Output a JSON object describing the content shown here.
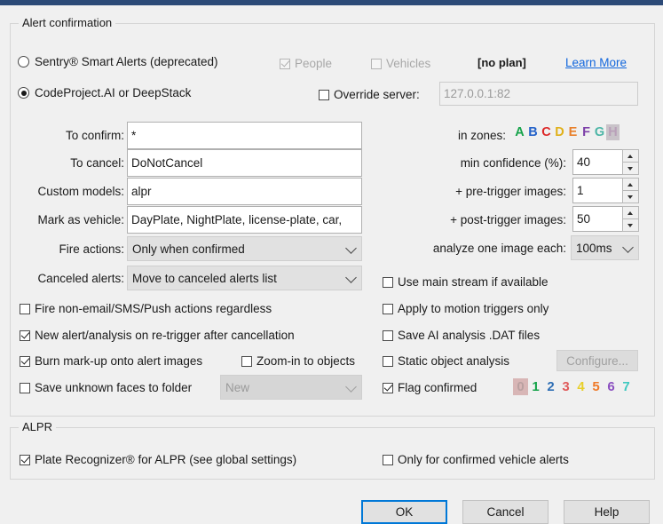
{
  "window": {
    "titlebar_color": "#2c4a77"
  },
  "alert_group": {
    "legend": "Alert confirmation",
    "radios": [
      {
        "label": "Sentry® Smart Alerts (deprecated)",
        "checked": false
      },
      {
        "label": "CodeProject.AI or DeepStack",
        "checked": true
      }
    ],
    "sentry_options": [
      {
        "label": "People",
        "checked": true,
        "disabled": true
      },
      {
        "label": "Vehicles",
        "checked": false,
        "disabled": true
      }
    ],
    "plan_text": "[no plan]",
    "learn_more": "Learn More",
    "override_server": {
      "label": "Override server:",
      "checked": false,
      "value": "127.0.0.1:82",
      "disabled": true
    },
    "fields": [
      {
        "label": "To confirm:",
        "value": "*"
      },
      {
        "label": "To cancel:",
        "value": "DoNotCancel"
      },
      {
        "label": "Custom models:",
        "value": "alpr"
      },
      {
        "label": "Mark as vehicle:",
        "value": "DayPlate, NightPlate, license-plate, car,"
      }
    ],
    "combos": [
      {
        "label": "Fire actions:",
        "value": "Only when confirmed"
      },
      {
        "label": "Canceled alerts:",
        "value": "Move to canceled alerts list"
      }
    ],
    "zones": {
      "label": "in zones:",
      "items": [
        {
          "letter": "A",
          "color": "#16a34a",
          "selected": false
        },
        {
          "letter": "B",
          "color": "#2563c9",
          "selected": false
        },
        {
          "letter": "C",
          "color": "#dc2626",
          "selected": false
        },
        {
          "letter": "D",
          "color": "#e0b019",
          "selected": false
        },
        {
          "letter": "E",
          "color": "#e8802a",
          "selected": false
        },
        {
          "letter": "F",
          "color": "#7c3fa8",
          "selected": false
        },
        {
          "letter": "G",
          "color": "#4bb5a6",
          "selected": false
        },
        {
          "letter": "H",
          "color": "#b9a0b9",
          "selected": true
        }
      ]
    },
    "spinners": [
      {
        "label": "min confidence (%):",
        "value": "40"
      },
      {
        "label": "+ pre-trigger images:",
        "value": "1"
      },
      {
        "label": "+ post-trigger images:",
        "value": "50"
      }
    ],
    "analyze": {
      "label": "analyze one image each:",
      "value": "100ms"
    },
    "left_checkboxes": [
      {
        "label": "Fire non-email/SMS/Push actions regardless",
        "checked": false
      },
      {
        "label": "New alert/analysis on re-trigger after cancellation",
        "checked": true
      },
      {
        "label": "Burn mark-up onto alert images",
        "checked": true
      },
      {
        "label": "Save unknown faces to folder",
        "checked": false
      }
    ],
    "zoom_in_objects": {
      "label": "Zoom-in to objects",
      "checked": false
    },
    "faces_folder": {
      "value": "New",
      "disabled": true
    },
    "right_checkboxes": [
      {
        "label": "Use main stream if available",
        "checked": false
      },
      {
        "label": "Apply to motion triggers only",
        "checked": false
      },
      {
        "label": "Save AI analysis .DAT files",
        "checked": false
      },
      {
        "label": "Static object analysis",
        "checked": false
      },
      {
        "label": "Flag confirmed",
        "checked": true
      }
    ],
    "configure_button": {
      "label": "Configure...",
      "disabled": true
    },
    "flags": [
      {
        "digit": "0",
        "color": "#b9a0a0",
        "selected": true
      },
      {
        "digit": "1",
        "color": "#16a34a",
        "selected": false
      },
      {
        "digit": "2",
        "color": "#2f6fb5",
        "selected": false
      },
      {
        "digit": "3",
        "color": "#e05a5a",
        "selected": false
      },
      {
        "digit": "4",
        "color": "#e8cf2a",
        "selected": false
      },
      {
        "digit": "5",
        "color": "#ef7a2a",
        "selected": false
      },
      {
        "digit": "6",
        "color": "#8b4fc0",
        "selected": false
      },
      {
        "digit": "7",
        "color": "#3fc9c0",
        "selected": false
      }
    ]
  },
  "alpr_group": {
    "legend": "ALPR",
    "checkboxes": [
      {
        "label": "Plate Recognizer® for ALPR (see global settings)",
        "checked": true
      },
      {
        "label": "Only for confirmed vehicle alerts",
        "checked": false
      }
    ]
  },
  "footer": {
    "ok": "OK",
    "cancel": "Cancel",
    "help": "Help"
  }
}
